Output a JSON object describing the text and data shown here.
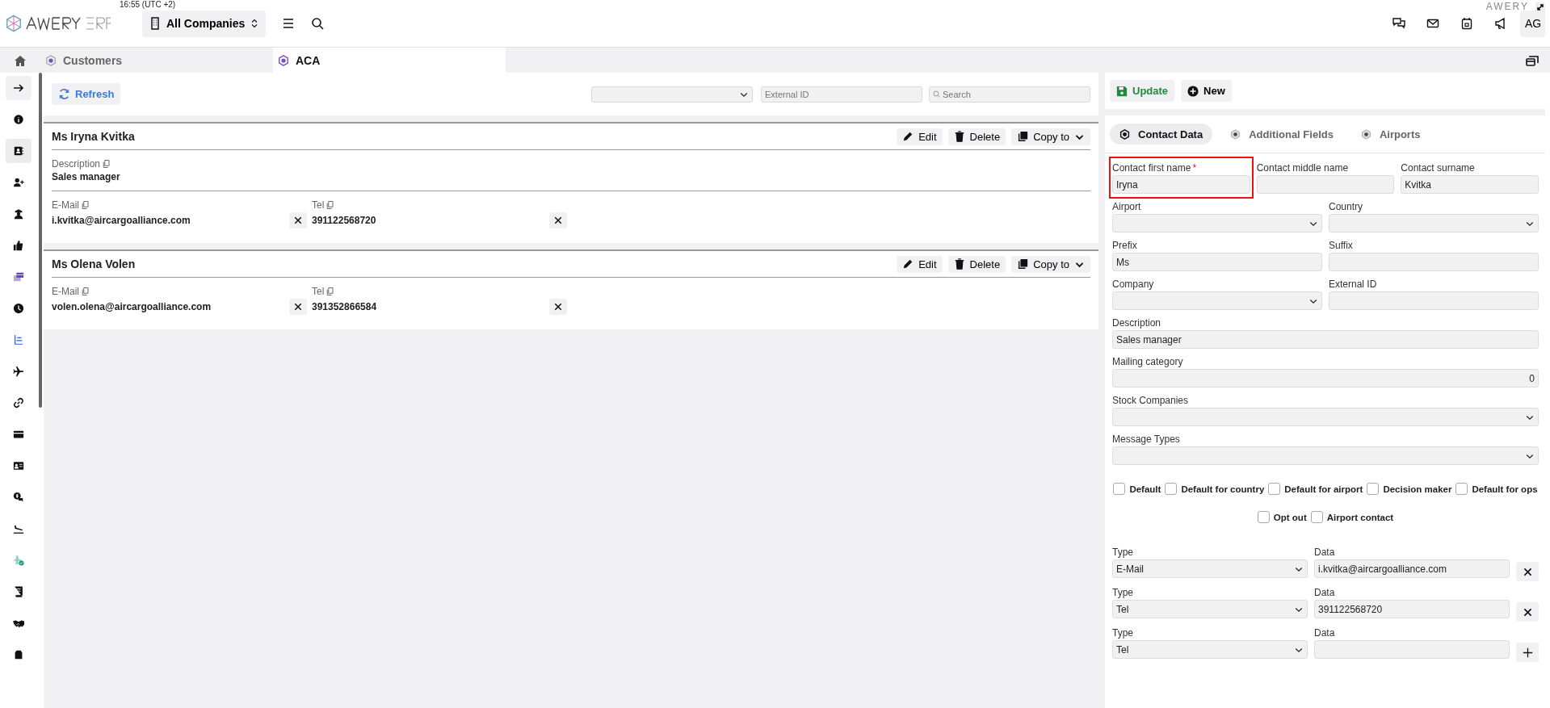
{
  "header": {
    "time": "16:55 (UTC +2)",
    "company_selector": "All Companies",
    "avatar": "AG",
    "brand_small": "AWERY"
  },
  "tabs": [
    {
      "label": "Customers",
      "selected": false
    },
    {
      "label": "ACA",
      "selected": true
    }
  ],
  "sidebar": {
    "items": [
      {
        "selected": false
      },
      {
        "selected": true
      },
      {
        "selected": false
      },
      {
        "selected": false
      },
      {
        "selected": false
      },
      {
        "selected": false
      },
      {
        "selected": false
      },
      {
        "selected": false
      },
      {
        "selected": false
      },
      {
        "selected": false
      },
      {
        "selected": false
      },
      {
        "selected": false
      },
      {
        "selected": false
      },
      {
        "selected": false
      },
      {
        "selected": false
      },
      {
        "selected": false
      },
      {
        "selected": false
      },
      {
        "selected": false
      }
    ]
  },
  "toolbar": {
    "refresh": "Refresh",
    "external_id": {
      "placeholder": "External ID"
    },
    "search": {
      "placeholder": "Search"
    }
  },
  "contacts": [
    {
      "name": "Ms Iryna Kvitka",
      "actions": [
        "Edit",
        "Delete",
        "Copy to"
      ],
      "sections": [
        [
          {
            "label": "Description",
            "value": "Sales manager",
            "removable": false
          }
        ],
        [
          {
            "label": "E-Mail",
            "value": "i.kvitka@aircargoalliance.com",
            "removable": true
          },
          {
            "label": "Tel",
            "value": "391122568720",
            "removable": true
          }
        ]
      ]
    },
    {
      "name": "Ms Olena Volen",
      "actions": [
        "Edit",
        "Delete",
        "Copy to"
      ],
      "sections": [
        [
          {
            "label": "E-Mail",
            "value": "volen.olena@aircargoalliance.com",
            "removable": true
          },
          {
            "label": "Tel",
            "value": "391352866584",
            "removable": true
          }
        ]
      ]
    }
  ],
  "detail": {
    "buttons": [
      {
        "kind": "update",
        "label": "Update"
      },
      {
        "kind": "new",
        "label": "New"
      }
    ],
    "tabs": [
      {
        "label": "Contact Data",
        "selected": true
      },
      {
        "label": "Additional Fields",
        "selected": false
      },
      {
        "label": "Airports",
        "selected": false
      }
    ],
    "form_rows": [
      [
        {
          "label": "Contact first name",
          "required_mark": "*",
          "value": "Iryna",
          "kind": "text",
          "highlighted": true
        },
        {
          "label": "Contact middle name",
          "kind": "text",
          "highlighted": false
        },
        {
          "label": "Contact surname",
          "value": "Kvitka",
          "kind": "text",
          "highlighted": false
        }
      ],
      [
        {
          "label": "Airport",
          "kind": "select",
          "highlighted": false
        },
        {
          "label": "Country",
          "kind": "select",
          "highlighted": false
        }
      ],
      [
        {
          "label": "Prefix",
          "value": "Ms",
          "kind": "text",
          "highlighted": false
        },
        {
          "label": "Suffix",
          "kind": "text",
          "highlighted": false
        }
      ],
      [
        {
          "label": "Company",
          "kind": "select",
          "highlighted": false
        },
        {
          "label": "External ID",
          "kind": "text",
          "highlighted": false
        }
      ],
      [
        {
          "label": "Description",
          "value": "Sales manager",
          "kind": "text",
          "highlighted": false
        }
      ],
      [
        {
          "label": "Mailing category",
          "value": "0",
          "kind": "number",
          "highlighted": false
        }
      ],
      [
        {
          "label": "Stock Companies",
          "kind": "select",
          "highlighted": false
        }
      ],
      [
        {
          "label": "Message Types",
          "kind": "select",
          "highlighted": false
        }
      ]
    ],
    "checkbox_rows": [
      [
        {
          "label": "Default",
          "checked": false
        },
        {
          "label": "Default for country",
          "checked": false
        },
        {
          "label": "Default for airport",
          "checked": false
        },
        {
          "label": "Decision maker",
          "checked": false
        },
        {
          "label": "Default for ops",
          "checked": false
        }
      ],
      [
        {
          "label": "Opt out",
          "checked": false
        },
        {
          "label": "Airport contact",
          "checked": false
        }
      ]
    ],
    "communications": [
      {
        "type_label": "Type",
        "type": "E-Mail",
        "data_label": "Data",
        "data": "i.kvitka@aircargoalliance.com",
        "kind": "remove"
      },
      {
        "type_label": "Type",
        "type": "Tel",
        "data_label": "Data",
        "data": "391122568720",
        "kind": "remove"
      },
      {
        "type_label": "Type",
        "type": "Tel",
        "data_label": "Data",
        "kind": "add"
      }
    ]
  }
}
